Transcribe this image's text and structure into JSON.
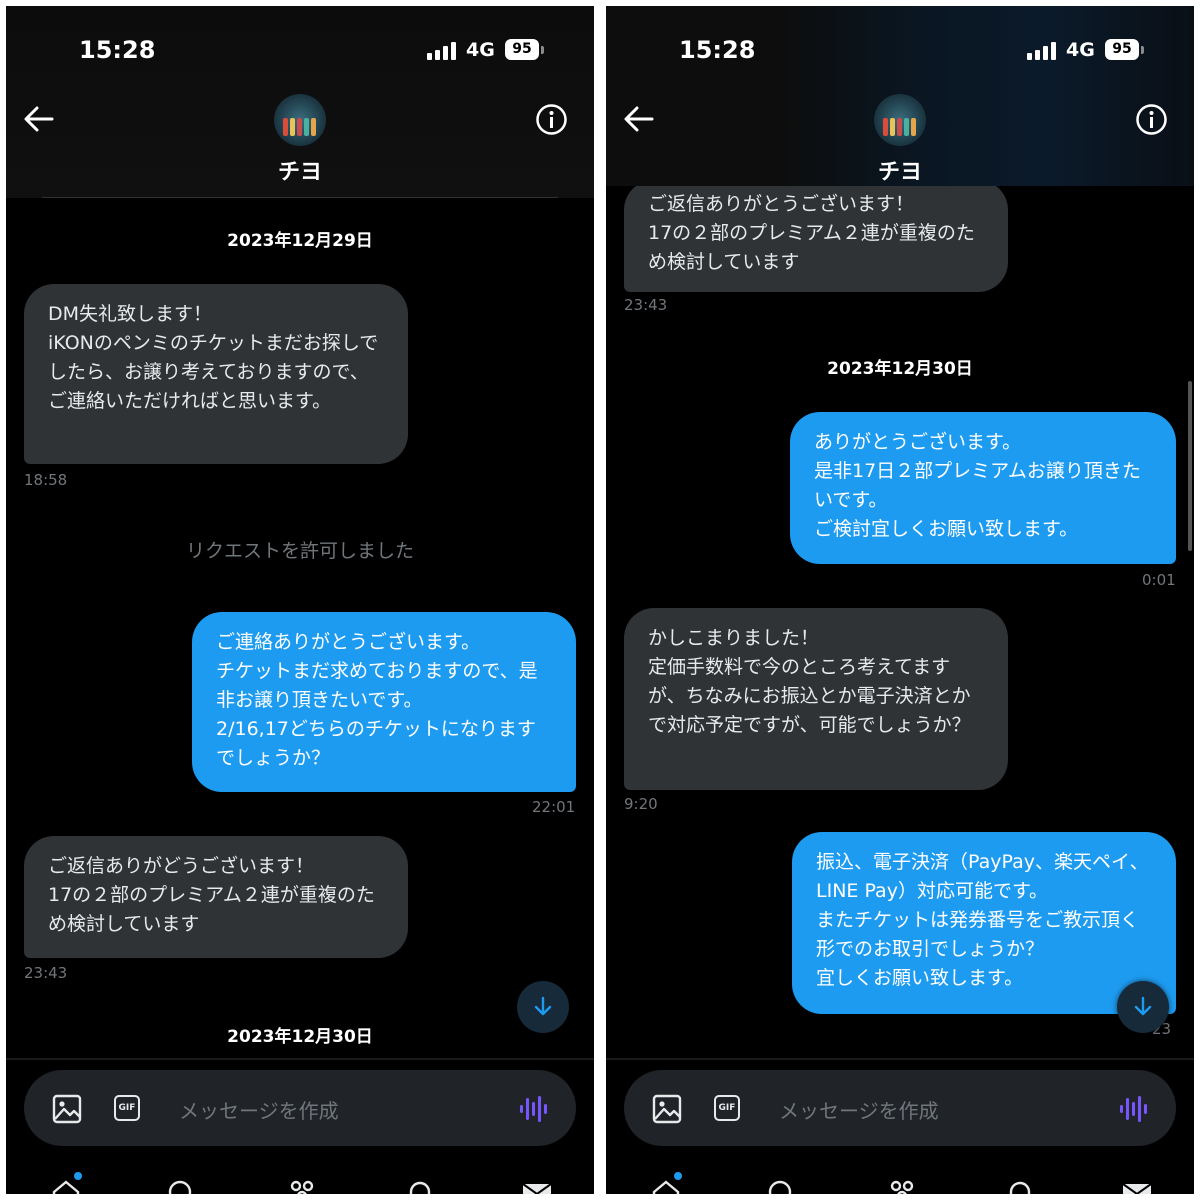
{
  "status": {
    "time": "15:28",
    "network": "4G",
    "battery": "95"
  },
  "conversation": {
    "name": "チヨ",
    "composer_placeholder": "メッセージを作成"
  },
  "left": {
    "date1": "2023年12月29日",
    "msg1": "DM失礼致します！\niKONのペンミのチケットまだお探しでしたら、お譲り考えておりますので、ご連絡いただければと思います。",
    "msg1_time": "18:58",
    "system": "リクエストを許可しました",
    "msg2": "ご連絡ありがとうございます。\nチケットまだ求めておりますので、是非お譲り頂きたいです。\n2/16,17どちらのチケットになりますでしょうか？",
    "msg2_time": "22:01",
    "msg3": "ご返信ありがどうございます！\n17の２部のプレミアム２連が重複のため検討しています",
    "msg3_time": "23:43",
    "date2": "2023年12月30日"
  },
  "right": {
    "msg3_partial": "ご返信ありがとうございます！\n17の２部のプレミアム２連が重複のため検討しています",
    "msg3_time": "23:43",
    "date2": "2023年12月30日",
    "msg4": "ありがとうございます。\n是非17日２部プレミアムお譲り頂きたいです。\nご検討宜しくお願い致します。",
    "msg4_time": "0:01",
    "msg5": "かしこまりました！\n定価手数料で今のところ考えてますが、ちなみにお振込とか電子決済とかで対応予定ですが、可能でしょうか？",
    "msg5_time": "9:20",
    "msg6": "振込、電子決済（PayPay、楽天ペイ、LINE Pay）対応可能です。\nまたチケットは発券番号をご教示頂く形でのお取引でしょうか？\n宜しくお願い致します。",
    "msg6_time_partial": "23"
  },
  "icons": {
    "back": "arrow-left-icon",
    "info": "info-icon",
    "image": "image-icon",
    "gif": "GIF",
    "voice": "voice-wave-icon",
    "scroll_down": "arrow-down-icon"
  },
  "colors": {
    "background": "#000000",
    "incoming_bubble": "#2f3336",
    "outgoing_bubble": "#1d9bf0",
    "timestamp": "#71767b",
    "accent_voice": "#7856ff"
  }
}
